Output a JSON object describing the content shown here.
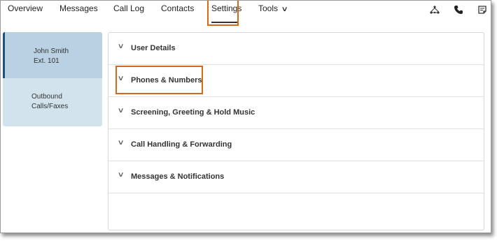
{
  "nav": {
    "tabs": [
      {
        "label": "Overview"
      },
      {
        "label": "Messages"
      },
      {
        "label": "Call Log"
      },
      {
        "label": "Contacts"
      },
      {
        "label": "Settings"
      },
      {
        "label": "Tools"
      }
    ],
    "active_tab": "Settings",
    "icons": [
      "network-icon",
      "phone-icon",
      "note-icon"
    ]
  },
  "sidebar": {
    "items": [
      {
        "line1": "John Smith",
        "line2": "Ext. 101"
      },
      {
        "line1": "Outbound",
        "line2": "Calls/Faxes"
      }
    ]
  },
  "sections": [
    {
      "label": "User Details"
    },
    {
      "label": "Phones & Numbers"
    },
    {
      "label": "Screening, Greeting & Hold Music"
    },
    {
      "label": "Call Handling & Forwarding"
    },
    {
      "label": "Messages & Notifications"
    }
  ],
  "colors": {
    "highlight": "#d2691e",
    "sidebar_active": "#b9d1e2",
    "sidebar_inactive": "#d3e3ee",
    "sidebar_accent": "#1f4e79"
  }
}
